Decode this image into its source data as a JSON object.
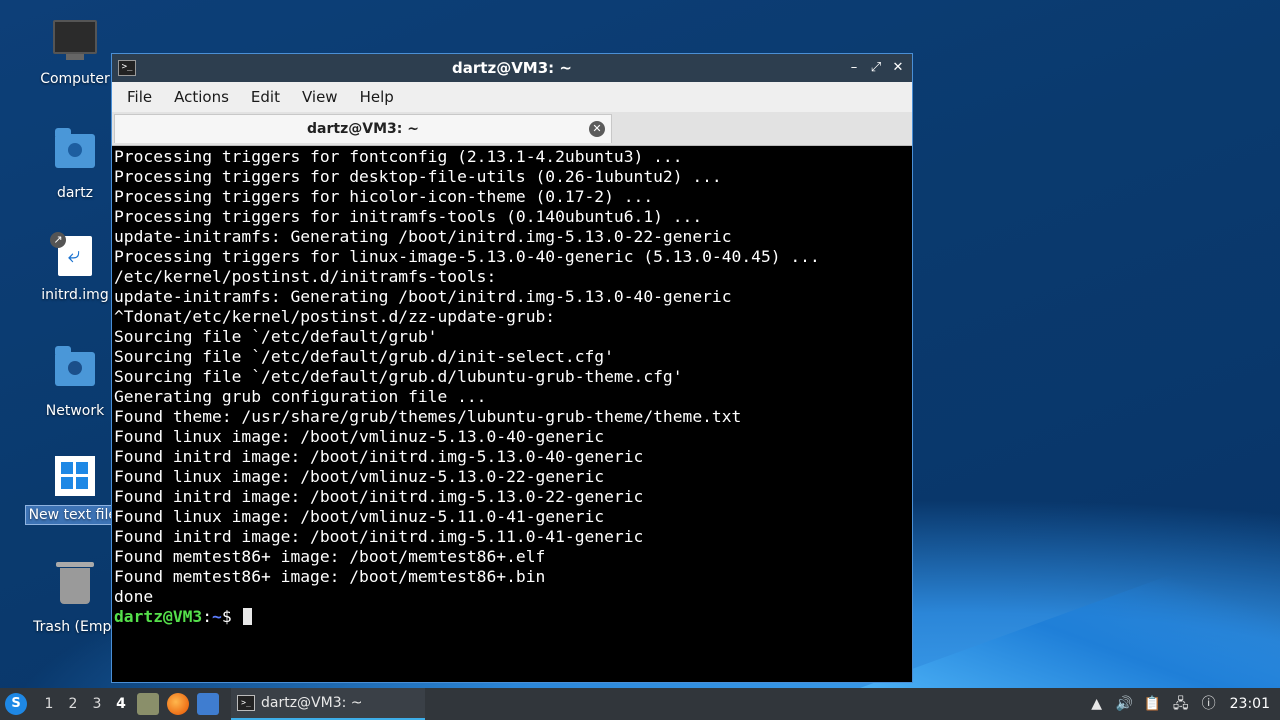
{
  "desktop": {
    "icons": [
      {
        "label": "Computer",
        "icon": "computer-icon"
      },
      {
        "label": "dartz",
        "icon": "home-folder-icon"
      },
      {
        "label": "initrd.img",
        "icon": "symlink-file-icon"
      },
      {
        "label": "Network",
        "icon": "network-folder-icon"
      },
      {
        "label": "New text file.",
        "icon": "text-file-icon",
        "selected": true
      },
      {
        "label": "Trash (Empt",
        "icon": "trash-icon"
      }
    ]
  },
  "window": {
    "title": "dartz@VM3: ~",
    "menus": [
      "File",
      "Actions",
      "Edit",
      "View",
      "Help"
    ],
    "tab_title": "dartz@VM3: ~",
    "terminal_lines": [
      "Processing triggers for fontconfig (2.13.1-4.2ubuntu3) ...",
      "Processing triggers for desktop-file-utils (0.26-1ubuntu2) ...",
      "Processing triggers for hicolor-icon-theme (0.17-2) ...",
      "Processing triggers for initramfs-tools (0.140ubuntu6.1) ...",
      "update-initramfs: Generating /boot/initrd.img-5.13.0-22-generic",
      "Processing triggers for linux-image-5.13.0-40-generic (5.13.0-40.45) ...",
      "/etc/kernel/postinst.d/initramfs-tools:",
      "update-initramfs: Generating /boot/initrd.img-5.13.0-40-generic",
      "^Tdonat/etc/kernel/postinst.d/zz-update-grub:",
      "Sourcing file `/etc/default/grub'",
      "Sourcing file `/etc/default/grub.d/init-select.cfg'",
      "Sourcing file `/etc/default/grub.d/lubuntu-grub-theme.cfg'",
      "Generating grub configuration file ...",
      "Found theme: /usr/share/grub/themes/lubuntu-grub-theme/theme.txt",
      "Found linux image: /boot/vmlinuz-5.13.0-40-generic",
      "Found initrd image: /boot/initrd.img-5.13.0-40-generic",
      "Found linux image: /boot/vmlinuz-5.13.0-22-generic",
      "Found initrd image: /boot/initrd.img-5.13.0-22-generic",
      "Found linux image: /boot/vmlinuz-5.11.0-41-generic",
      "Found initrd image: /boot/initrd.img-5.11.0-41-generic",
      "Found memtest86+ image: /boot/memtest86+.elf",
      "Found memtest86+ image: /boot/memtest86+.bin",
      "done"
    ],
    "prompt": {
      "user_host": "dartz@VM3",
      "sep": ":",
      "path": "~",
      "symbol": "$ "
    }
  },
  "taskbar": {
    "workspaces": [
      "1",
      "2",
      "3",
      "4"
    ],
    "active_workspace": "4",
    "task_label": "dartz@VM3: ~",
    "clock": "23:01"
  },
  "colors": {
    "prompt_user": "#55e04b",
    "prompt_path": "#5c7dff",
    "accent": "#3daee9"
  }
}
